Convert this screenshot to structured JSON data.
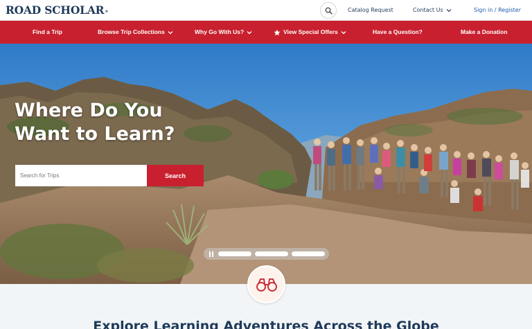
{
  "header": {
    "logo_text": "ROAD SCHOLAR",
    "logo_mark": "®",
    "search_icon": "search-icon",
    "catalog_request": "Catalog Request",
    "contact_us": "Contact Us",
    "sign_in": "Sign in / Register"
  },
  "nav": {
    "items": [
      {
        "label": "Find a Trip"
      },
      {
        "label": "Browse Trip Collections"
      },
      {
        "label": "Why Go With Us?"
      },
      {
        "label": "View Special Offers"
      },
      {
        "label": "Have a Question?"
      },
      {
        "label": "Make a Donation"
      }
    ]
  },
  "hero": {
    "title_line1": "Where Do You",
    "title_line2": "Want to Learn?",
    "search_placeholder": "Search for Trips",
    "search_button": "Search",
    "carousel_slides": 3
  },
  "section": {
    "badge_icon": "binoculars-icon",
    "title": "Explore Learning Adventures Across the Globe"
  },
  "colors": {
    "brand_red": "#c8202e",
    "navy": "#1f3a5a",
    "link_blue": "#1f5aa8"
  }
}
